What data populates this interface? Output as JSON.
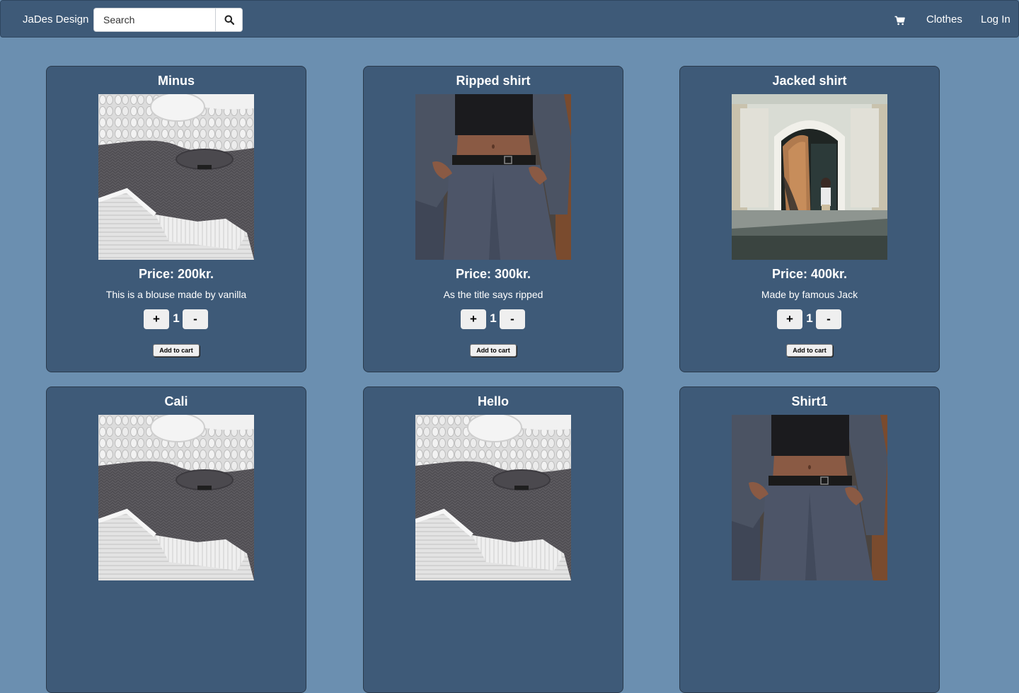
{
  "navbar": {
    "brand": "JaDes Design",
    "search_placeholder": "Search",
    "search_icon": "search-icon",
    "cart_icon": "shopping-cart-icon",
    "clothes_label": "Clothes",
    "login_label": "Log In"
  },
  "products": [
    {
      "title": "Minus",
      "image": "knit-sweaters-image",
      "price": "Price: 200kr.",
      "description": "This is a blouse made by vanilla",
      "quantity": "1",
      "plus_label": "+",
      "minus_label": "-",
      "add_label": "Add to cart"
    },
    {
      "title": "Ripped shirt",
      "image": "grey-suit-image",
      "price": "Price: 300kr.",
      "description": "As the title says ripped",
      "quantity": "1",
      "plus_label": "+",
      "minus_label": "-",
      "add_label": "Add to cart"
    },
    {
      "title": "Jacked shirt",
      "image": "doorway-photo-image",
      "price": "Price: 400kr.",
      "description": "Made by famous Jack",
      "quantity": "1",
      "plus_label": "+",
      "minus_label": "-",
      "add_label": "Add to cart"
    },
    {
      "title": "Cali",
      "image": "knit-sweaters-image",
      "price": "",
      "description": "",
      "quantity": "",
      "plus_label": "",
      "minus_label": "",
      "add_label": ""
    },
    {
      "title": "Hello",
      "image": "knit-sweaters-image",
      "price": "",
      "description": "",
      "quantity": "",
      "plus_label": "",
      "minus_label": "",
      "add_label": ""
    },
    {
      "title": "Shirt1",
      "image": "grey-suit-image",
      "price": "",
      "description": "",
      "quantity": "",
      "plus_label": "",
      "minus_label": "",
      "add_label": ""
    }
  ],
  "colors": {
    "page_background": "#6b8fb0",
    "navbar_background": "#3e5a78",
    "card_background": "#3e5a78",
    "text": "#ffffff"
  }
}
